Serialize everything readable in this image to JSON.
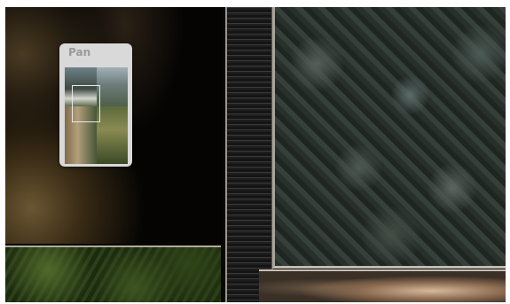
{
  "pan_panel": {
    "title": "Pan"
  }
}
